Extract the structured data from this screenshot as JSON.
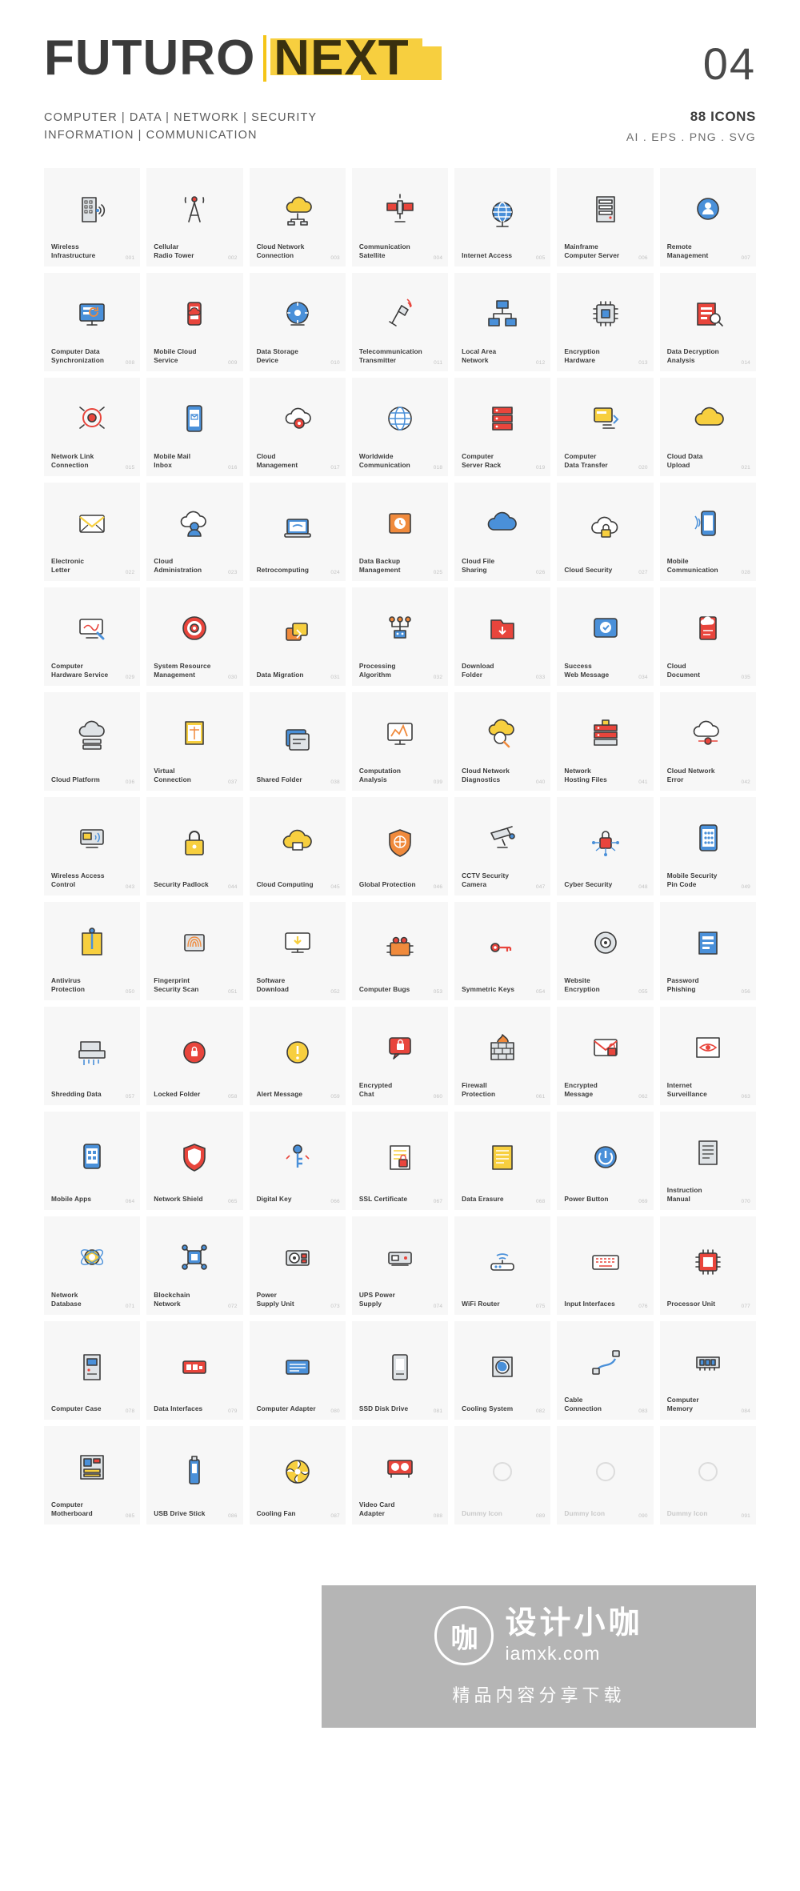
{
  "header": {
    "logo_part1": "FUTURO",
    "logo_part2": "NEXT",
    "set_number": "04",
    "subhead_line1": "COMPUTER | DATA | NETWORK | SECURITY",
    "subhead_line2": "INFORMATION | COMMUNICATION",
    "icon_count": "88 ICONS",
    "formats": "AI . EPS . PNG . SVG"
  },
  "watermark": {
    "mark": "咖",
    "cn_text": "设计小咖",
    "url": "iamxk.com",
    "tagline": "精品内容分享下载"
  },
  "icons": [
    {
      "label": "Wireless\nInfrastructure",
      "num": "001",
      "glyph": "building"
    },
    {
      "label": "Cellular\nRadio Tower",
      "num": "002",
      "glyph": "tower"
    },
    {
      "label": "Cloud Network\nConnection",
      "num": "003",
      "glyph": "cloud-net"
    },
    {
      "label": "Communication\nSatellite",
      "num": "004",
      "glyph": "satellite"
    },
    {
      "label": "Internet Access",
      "num": "005",
      "glyph": "globe"
    },
    {
      "label": "Mainframe\nComputer Server",
      "num": "006",
      "glyph": "mainframe"
    },
    {
      "label": "Remote\nManagement",
      "num": "007",
      "glyph": "remote-user"
    },
    {
      "label": "Computer Data\nSynchronization",
      "num": "008",
      "glyph": "monitor-sync"
    },
    {
      "label": "Mobile Cloud\nService",
      "num": "009",
      "glyph": "mobile-cloud"
    },
    {
      "label": "Data Storage\nDevice",
      "num": "010",
      "glyph": "storage"
    },
    {
      "label": "Telecommunication\nTransmitter",
      "num": "011",
      "glyph": "transmitter"
    },
    {
      "label": "Local Area\nNetwork",
      "num": "012",
      "glyph": "lan"
    },
    {
      "label": "Encryption\nHardware",
      "num": "013",
      "glyph": "chip"
    },
    {
      "label": "Data Decryption\nAnalysis",
      "num": "014",
      "glyph": "decrypt"
    },
    {
      "label": "Network Link\nConnection",
      "num": "015",
      "glyph": "link"
    },
    {
      "label": "Mobile Mail\nInbox",
      "num": "016",
      "glyph": "mobile-mail"
    },
    {
      "label": "Cloud\nManagement",
      "num": "017",
      "glyph": "cloud-gear"
    },
    {
      "label": "Worldwide\nCommunication",
      "num": "018",
      "glyph": "world"
    },
    {
      "label": "Computer\nServer Rack",
      "num": "019",
      "glyph": "rack"
    },
    {
      "label": "Computer\nData Transfer",
      "num": "020",
      "glyph": "transfer"
    },
    {
      "label": "Cloud Data\nUpload",
      "num": "021",
      "glyph": "cloud-up"
    },
    {
      "label": "Electronic\nLetter",
      "num": "022",
      "glyph": "envelope"
    },
    {
      "label": "Cloud\nAdministration",
      "num": "023",
      "glyph": "cloud-admin"
    },
    {
      "label": "Retrocomputing",
      "num": "024",
      "glyph": "laptop"
    },
    {
      "label": "Data Backup\nManagement",
      "num": "025",
      "glyph": "backup"
    },
    {
      "label": "Cloud File\nSharing",
      "num": "026",
      "glyph": "cloud-share"
    },
    {
      "label": "Cloud Security",
      "num": "027",
      "glyph": "cloud-lock"
    },
    {
      "label": "Mobile\nCommunication",
      "num": "028",
      "glyph": "mobile-comm"
    },
    {
      "label": "Computer\nHardware Service",
      "num": "029",
      "glyph": "hw-service"
    },
    {
      "label": "System Resource\nManagement",
      "num": "030",
      "glyph": "resource"
    },
    {
      "label": "Data Migration",
      "num": "031",
      "glyph": "migration"
    },
    {
      "label": "Processing\nAlgorithm",
      "num": "032",
      "glyph": "algorithm"
    },
    {
      "label": "Download\nFolder",
      "num": "033",
      "glyph": "dl-folder"
    },
    {
      "label": "Success\nWeb Message",
      "num": "034",
      "glyph": "success"
    },
    {
      "label": "Cloud\nDocument",
      "num": "035",
      "glyph": "cloud-doc"
    },
    {
      "label": "Cloud Platform",
      "num": "036",
      "glyph": "cloud-platform"
    },
    {
      "label": "Virtual\nConnection",
      "num": "037",
      "glyph": "virtual"
    },
    {
      "label": "Shared Folder",
      "num": "038",
      "glyph": "shared-folder"
    },
    {
      "label": "Computation\nAnalysis",
      "num": "039",
      "glyph": "computation"
    },
    {
      "label": "Cloud Network\nDiagnostics",
      "num": "040",
      "glyph": "diagnostics"
    },
    {
      "label": "Network\nHosting Files",
      "num": "041",
      "glyph": "hosting"
    },
    {
      "label": "Cloud Network\nError",
      "num": "042",
      "glyph": "cloud-error"
    },
    {
      "label": "Wireless Access\nControl",
      "num": "043",
      "glyph": "wireless-access"
    },
    {
      "label": "Security Padlock",
      "num": "044",
      "glyph": "padlock"
    },
    {
      "label": "Cloud Computing",
      "num": "045",
      "glyph": "cloud-computing"
    },
    {
      "label": "Global Protection",
      "num": "046",
      "glyph": "shield-globe"
    },
    {
      "label": "CCTV Security\nCamera",
      "num": "047",
      "glyph": "cctv"
    },
    {
      "label": "Cyber Security",
      "num": "048",
      "glyph": "cyber-lock"
    },
    {
      "label": "Mobile Security\nPin Code",
      "num": "049",
      "glyph": "pin-code"
    },
    {
      "label": "Antivirus\nProtection",
      "num": "050",
      "glyph": "antivirus"
    },
    {
      "label": "Fingerprint\nSecurity Scan",
      "num": "051",
      "glyph": "fingerprint"
    },
    {
      "label": "Software\nDownload",
      "num": "052",
      "glyph": "sw-download"
    },
    {
      "label": "Computer Bugs",
      "num": "053",
      "glyph": "bug"
    },
    {
      "label": "Symmetric Keys",
      "num": "054",
      "glyph": "keys"
    },
    {
      "label": "Website\nEncryption",
      "num": "055",
      "glyph": "web-encrypt"
    },
    {
      "label": "Password\nPhishing",
      "num": "056",
      "glyph": "phishing"
    },
    {
      "label": "Shredding Data",
      "num": "057",
      "glyph": "shredder"
    },
    {
      "label": "Locked Folder",
      "num": "058",
      "glyph": "locked-folder"
    },
    {
      "label": "Alert Message",
      "num": "059",
      "glyph": "alert"
    },
    {
      "label": "Encrypted\nChat",
      "num": "060",
      "glyph": "enc-chat"
    },
    {
      "label": "Firewall\nProtection",
      "num": "061",
      "glyph": "firewall"
    },
    {
      "label": "Encrypted\nMessage",
      "num": "062",
      "glyph": "enc-message"
    },
    {
      "label": "Internet\nSurveillance",
      "num": "063",
      "glyph": "surveillance"
    },
    {
      "label": "Mobile Apps",
      "num": "064",
      "glyph": "mobile-apps"
    },
    {
      "label": "Network Shield",
      "num": "065",
      "glyph": "net-shield"
    },
    {
      "label": "Digital Key",
      "num": "066",
      "glyph": "digital-key"
    },
    {
      "label": "SSL Certificate",
      "num": "067",
      "glyph": "ssl"
    },
    {
      "label": "Data Erasure",
      "num": "068",
      "glyph": "erasure"
    },
    {
      "label": "Power Button",
      "num": "069",
      "glyph": "power"
    },
    {
      "label": "Instruction\nManual",
      "num": "070",
      "glyph": "manual"
    },
    {
      "label": "Network\nDatabase",
      "num": "071",
      "glyph": "net-db"
    },
    {
      "label": "Blockchain\nNetwork",
      "num": "072",
      "glyph": "blockchain"
    },
    {
      "label": "Power\nSupply Unit",
      "num": "073",
      "glyph": "psu"
    },
    {
      "label": "UPS Power\nSupply",
      "num": "074",
      "glyph": "ups"
    },
    {
      "label": "WiFi Router",
      "num": "075",
      "glyph": "router"
    },
    {
      "label": "Input Interfaces",
      "num": "076",
      "glyph": "keyboard"
    },
    {
      "label": "Processor Unit",
      "num": "077",
      "glyph": "processor"
    },
    {
      "label": "Computer Case",
      "num": "078",
      "glyph": "case"
    },
    {
      "label": "Data Interfaces",
      "num": "079",
      "glyph": "interfaces"
    },
    {
      "label": "Computer Adapter",
      "num": "080",
      "glyph": "adapter"
    },
    {
      "label": "SSD Disk Drive",
      "num": "081",
      "glyph": "ssd"
    },
    {
      "label": "Cooling System",
      "num": "082",
      "glyph": "cooling"
    },
    {
      "label": "Cable\nConnection",
      "num": "083",
      "glyph": "cable"
    },
    {
      "label": "Computer\nMemory",
      "num": "084",
      "glyph": "memory"
    },
    {
      "label": "Computer\nMotherboard",
      "num": "085",
      "glyph": "motherboard"
    },
    {
      "label": "USB Drive Stick",
      "num": "086",
      "glyph": "usb"
    },
    {
      "label": "Cooling Fan",
      "num": "087",
      "glyph": "fan"
    },
    {
      "label": "Video Card\nAdapter",
      "num": "088",
      "glyph": "gpu"
    },
    {
      "label": "Dummy Icon",
      "num": "089",
      "glyph": "dummy"
    },
    {
      "label": "Dummy Icon",
      "num": "090",
      "glyph": "dummy"
    },
    {
      "label": "Dummy Icon",
      "num": "091",
      "glyph": "dummy"
    }
  ],
  "palette": {
    "yellow": "#f7cf3f",
    "orange": "#f08a3c",
    "red": "#e8453c",
    "blue": "#4a90d9",
    "dark": "#3b3b3b",
    "grey": "#9aa0a6",
    "cell_bg": "#f7f7f7"
  }
}
